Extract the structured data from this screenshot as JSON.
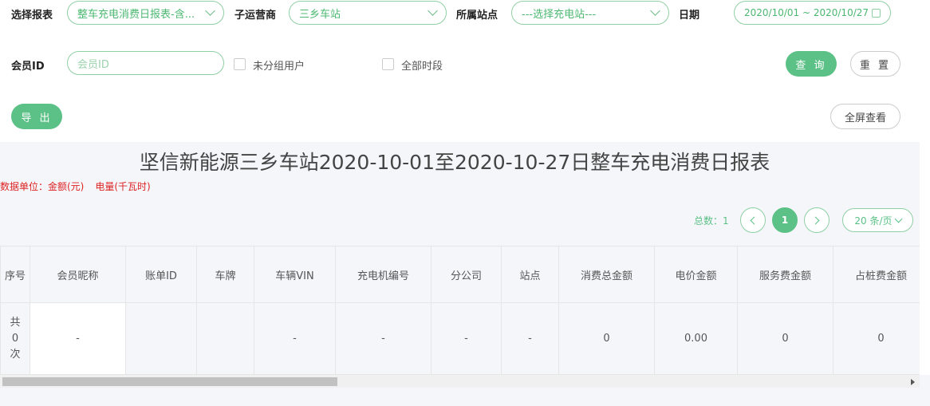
{
  "filters": {
    "report_label": "选择报表",
    "report_value": "整车充电消费日报表-含...",
    "operator_label": "子运营商",
    "operator_value": "三乡车站",
    "station_label": "所属站点",
    "station_value": "---选择充电站---",
    "date_label": "日期",
    "date_value": "2020/10/01 ~ 2020/10/27",
    "member_label": "会员ID",
    "member_placeholder": "会员ID",
    "ungrouped_label": "未分组用户",
    "alltime_label": "全部时段",
    "query_label": "查 询",
    "reset_label": "重 置",
    "export_label": "导 出",
    "fullscreen_label": "全屏查看"
  },
  "report": {
    "title": "坚信新能源三乡车站2020-10-01至2020-10-27日整车充电消费日报表",
    "unit_amount": "数据单位：金额(元)",
    "unit_energy": "电量(千瓦时)"
  },
  "pagination": {
    "total_label": "总数：1",
    "current_page": "1",
    "page_size": "20 条/页"
  },
  "table": {
    "columns": [
      "序号",
      "会员昵称",
      "账单ID",
      "车牌",
      "车辆VIN",
      "充电机编号",
      "分公司",
      "站点",
      "消费总金额",
      "电价金额",
      "服务费金额",
      "占桩费金额"
    ],
    "summary_row": [
      "共0次",
      "-",
      "",
      "",
      "-",
      "-",
      "-",
      "-",
      "0",
      "0.00",
      "0",
      "0"
    ]
  },
  "colors": {
    "accent": "#5cc186",
    "warning_text": "#dd2222"
  }
}
